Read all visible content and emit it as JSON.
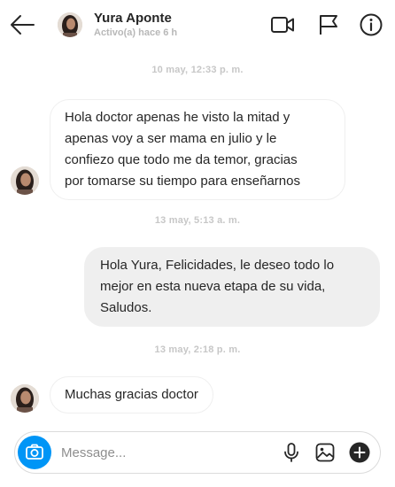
{
  "header": {
    "name": "Yura Aponte",
    "status": "Activo(a) hace 6 h"
  },
  "messages": [
    {
      "type": "timestamp",
      "text": "10 may, 12:33 p. m."
    },
    {
      "type": "incoming",
      "lines": [
        "Hola doctor apenas he visto la mitad y",
        "apenas voy a ser mama en julio y le",
        "confiezo que todo me da temor, gracias",
        "por tomarse su tiempo para enseñarnos"
      ]
    },
    {
      "type": "timestamp",
      "text": "13 may, 5:13 a. m."
    },
    {
      "type": "outgoing",
      "lines": [
        "Hola Yura, Felicidades, le deseo todo lo",
        "mejor en esta nueva etapa de su vida,",
        "Saludos."
      ]
    },
    {
      "type": "timestamp",
      "text": "13 may, 2:18 p. m."
    },
    {
      "type": "incoming",
      "lines": [
        "Muchas gracias doctor"
      ]
    }
  ],
  "composer": {
    "placeholder": "Message..."
  },
  "colors": {
    "accent": "#0095f6",
    "incoming_border": "#efefef",
    "outgoing_bg": "#efefef",
    "timestamp": "#c7c7c7"
  },
  "icons": [
    "back-arrow-icon",
    "video-call-icon",
    "flag-icon",
    "info-icon",
    "camera-icon",
    "microphone-icon",
    "gallery-icon",
    "plus-circle-icon"
  ]
}
